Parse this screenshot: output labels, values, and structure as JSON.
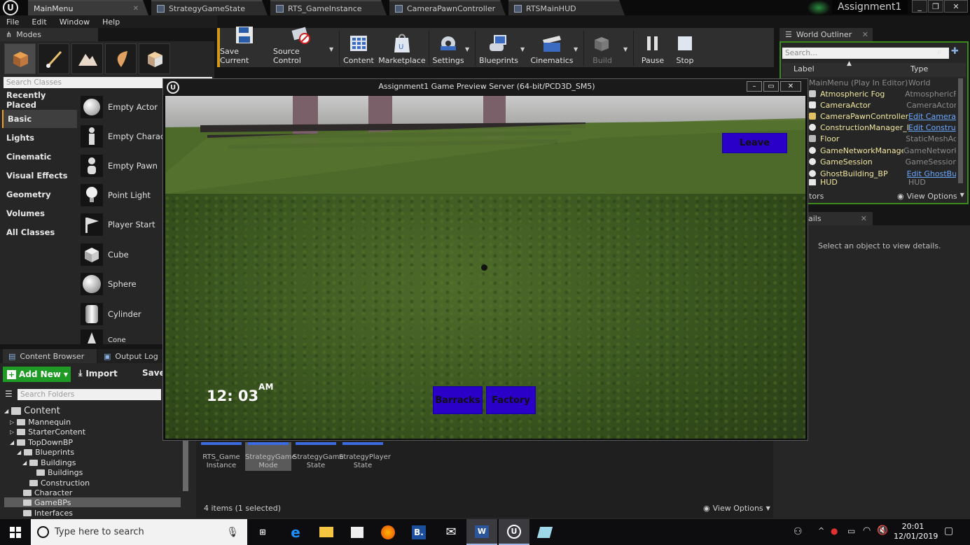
{
  "tabs": {
    "main": "MainMenu",
    "t1": "StrategyGameState",
    "t2": "RTS_GameInstance",
    "t3": "CameraPawnController",
    "t4": "RTSMainHUD",
    "project": "Assignment1"
  },
  "menu": {
    "file": "File",
    "edit": "Edit",
    "window": "Window",
    "help": "Help"
  },
  "modes": {
    "tab": "Modes",
    "search_placeholder": "Search Classes",
    "categories": [
      "Recently Placed",
      "Basic",
      "Lights",
      "Cinematic",
      "Visual Effects",
      "Geometry",
      "Volumes",
      "All Classes"
    ],
    "items": [
      "Empty Actor",
      "Empty Charact",
      "Empty Pawn",
      "Point Light",
      "Player Start",
      "Cube",
      "Sphere",
      "Cylinder",
      "Cone"
    ]
  },
  "toolbar": {
    "save": "Save Current",
    "source": "Source Control",
    "content": "Content",
    "marketplace": "Marketplace",
    "settings": "Settings",
    "blueprints": "Blueprints",
    "cinematics": "Cinematics",
    "build": "Build",
    "pause": "Pause",
    "stop": "Stop"
  },
  "game": {
    "title": "Assignment1 Game Preview Server (64-bit/PCD3D_SM5)",
    "leave": "Leave",
    "barracks": "Barracks",
    "factory": "Factory",
    "clock": "12: 03",
    "ampm": "AM"
  },
  "outliner": {
    "tab": "World Outliner",
    "search_placeholder": "Search...",
    "col_label": "Label",
    "col_type": "Type",
    "rows": [
      {
        "label": "MainMenu (Play In Editor)",
        "type": "World"
      },
      {
        "label": "Atmospheric Fog",
        "type": "AtmosphericF"
      },
      {
        "label": "CameraActor",
        "type": "CameraActor"
      },
      {
        "label": "CameraPawnController",
        "type": "Edit Camera"
      },
      {
        "label": "ConstructionManager_B",
        "type": "Edit Constru"
      },
      {
        "label": "Floor",
        "type": "StaticMeshAc"
      },
      {
        "label": "GameNetworkManager",
        "type": "GameNetwork"
      },
      {
        "label": "GameSession",
        "type": "GameSession"
      },
      {
        "label": "GhostBuilding_BP",
        "type": "Edit GhostBu"
      },
      {
        "label": "HUD",
        "type": "HUD"
      }
    ],
    "actors": "tors",
    "view_options": "View Options"
  },
  "details": {
    "tab": "ails",
    "message": "Select an object to view details."
  },
  "content_browser": {
    "tab": "Content Browser",
    "output_log": "Output Log",
    "add_new": "Add New",
    "import": "Import",
    "save": "Save",
    "search_placeholder": "Search Folders",
    "tree": [
      "Content",
      "Mannequin",
      "StarterContent",
      "TopDownBP",
      "Blueprints",
      "Buildings",
      "Buildings",
      "Construction",
      "Character",
      "GameBPs",
      "Interfaces"
    ],
    "assets": [
      {
        "l1": "RTS_Game",
        "l2": "Instance"
      },
      {
        "l1": "StrategyGame",
        "l2": "Mode"
      },
      {
        "l1": "StrategyGame",
        "l2": "State"
      },
      {
        "l1": "StrategyPlayer",
        "l2": "State"
      }
    ],
    "count": "4 items (1 selected)",
    "view_options": "View Options"
  },
  "taskbar": {
    "search_placeholder": "Type here to search",
    "time": "20:01",
    "date": "12/01/2019"
  }
}
